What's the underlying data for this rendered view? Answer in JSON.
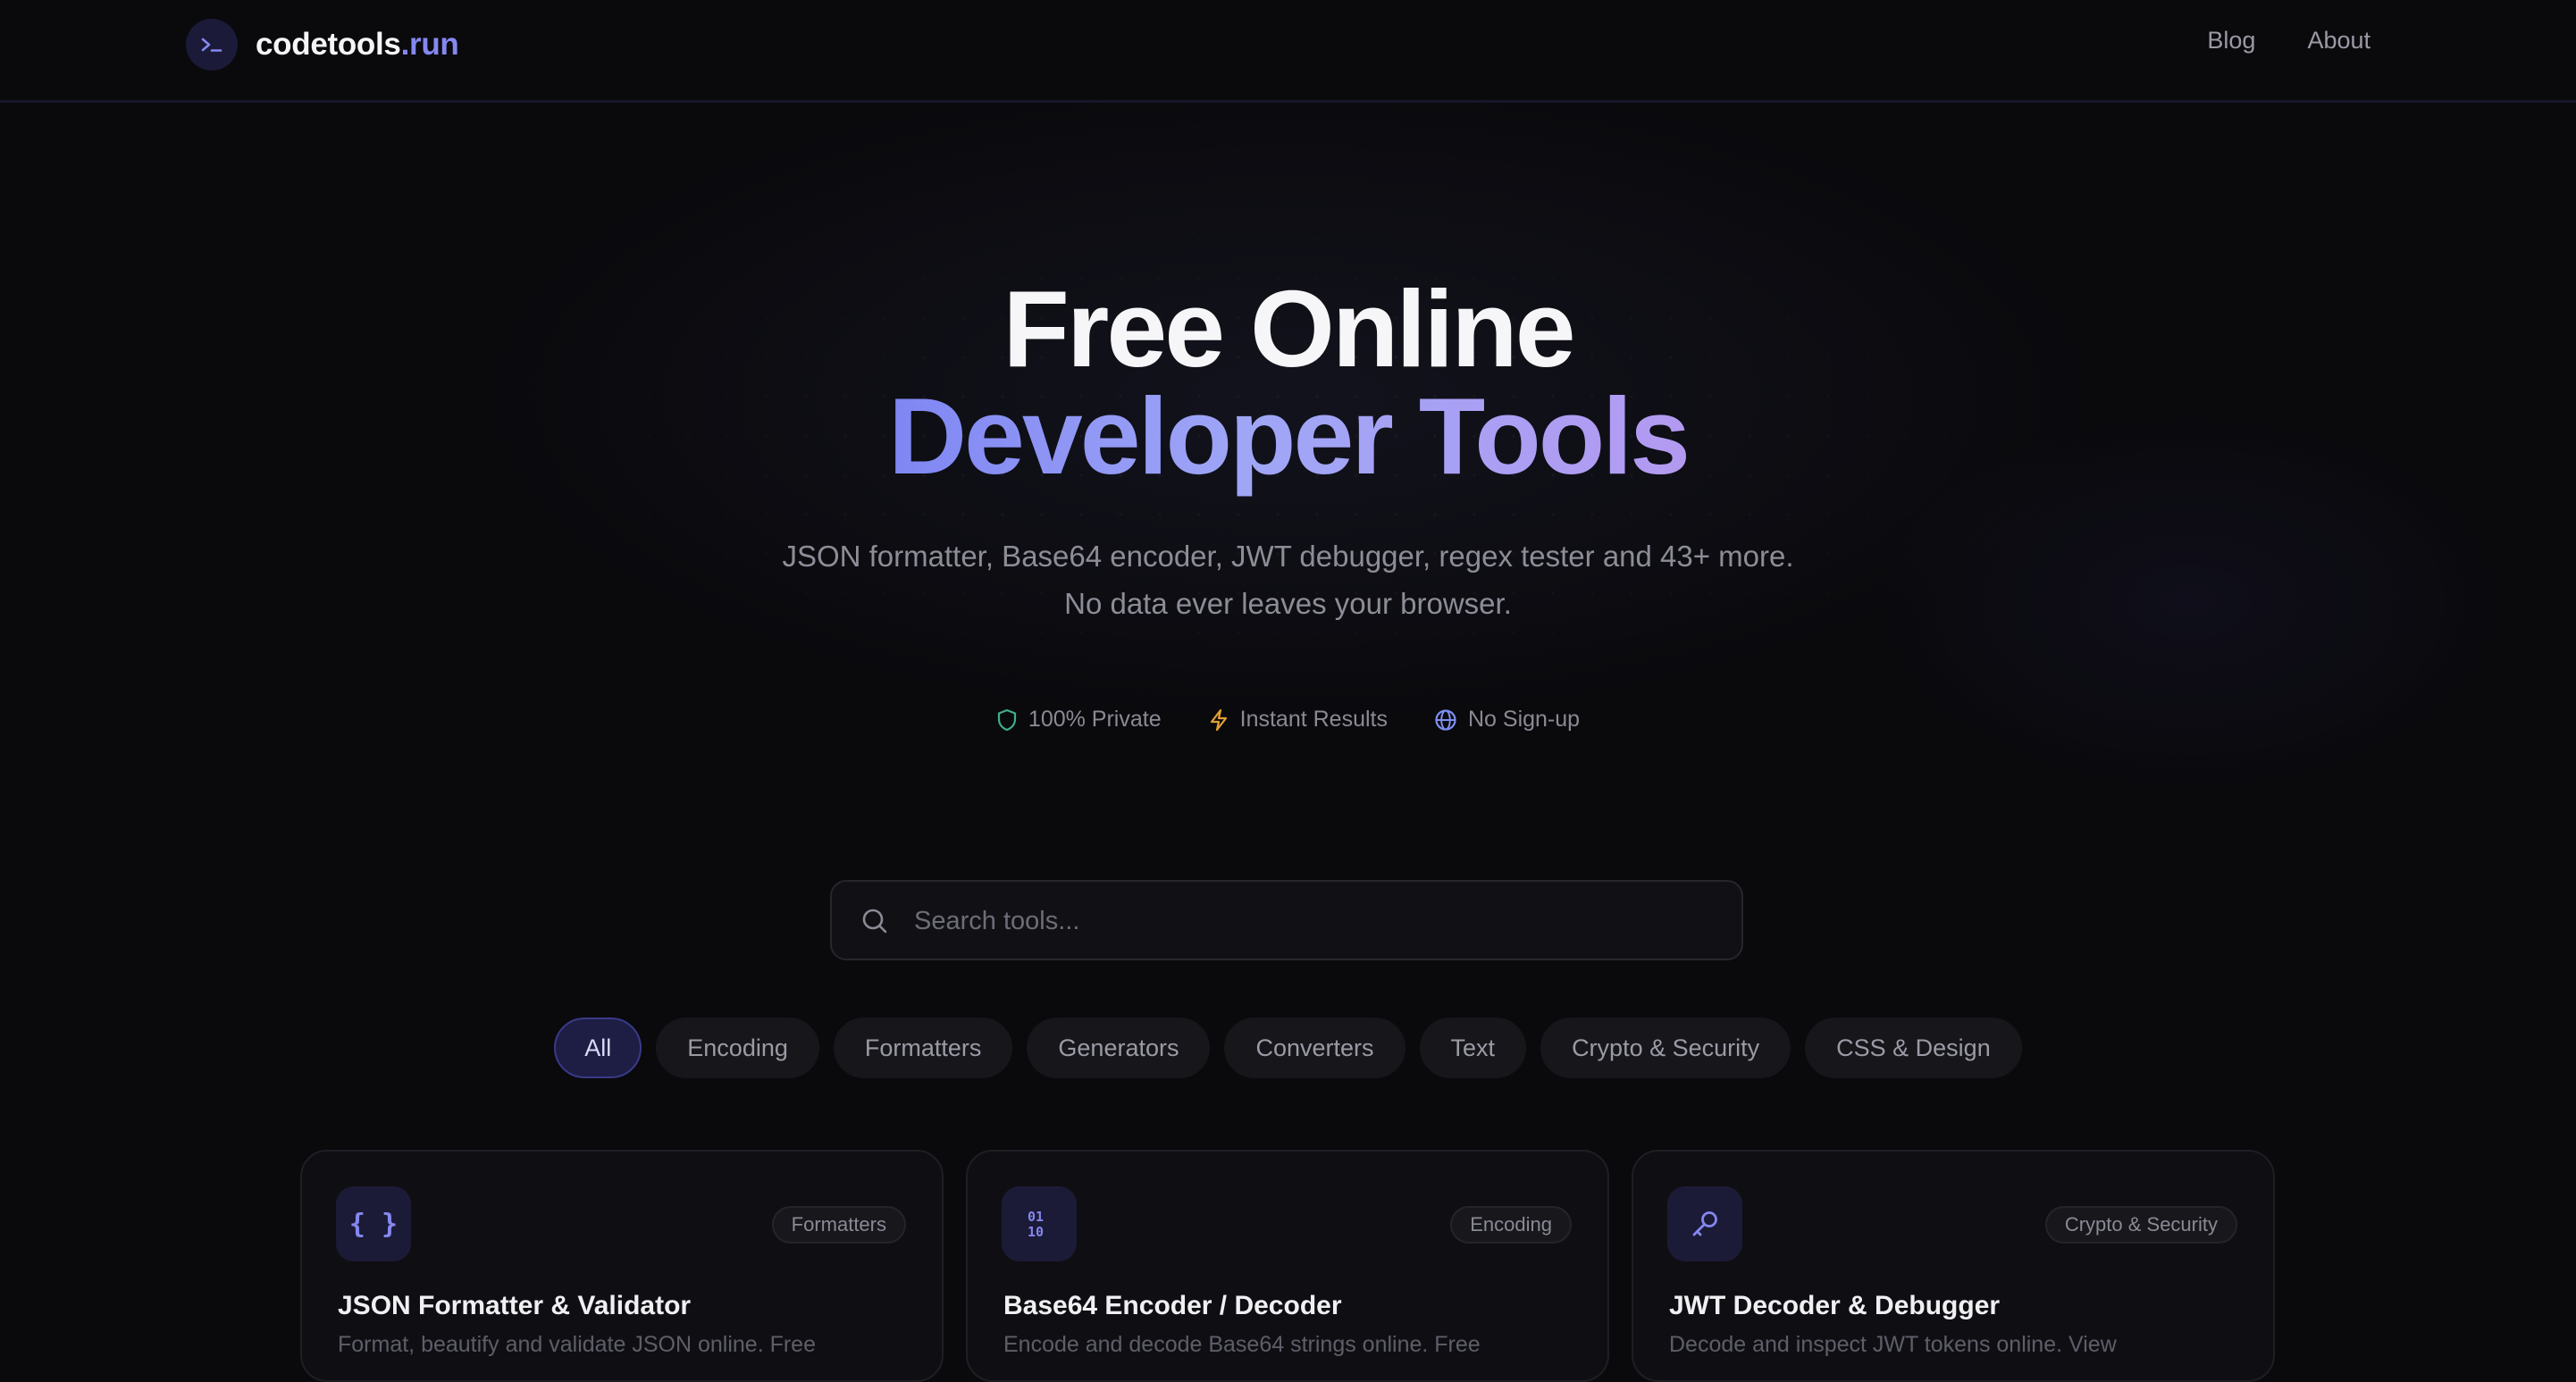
{
  "header": {
    "logo_text": "codetools",
    "logo_accent": ".run",
    "logo_prompt": ">_",
    "nav": [
      {
        "label": "Blog"
      },
      {
        "label": "About"
      }
    ]
  },
  "hero": {
    "title_line1": "Free Online",
    "title_line2": "Developer Tools",
    "subtitle_line1": "JSON formatter, Base64 encoder, JWT debugger, regex tester and 43+ more.",
    "subtitle_line2": "No data ever leaves your browser.",
    "features": [
      {
        "label": "100% Private",
        "icon": "shield-icon",
        "color": "#3fae8a"
      },
      {
        "label": "Instant Results",
        "icon": "lightning-icon",
        "color": "#e0a132"
      },
      {
        "label": "No Sign-up",
        "icon": "globe-icon",
        "color": "#7d8ff0"
      }
    ]
  },
  "search": {
    "placeholder": "Search tools..."
  },
  "categories": [
    {
      "label": "All",
      "active": true
    },
    {
      "label": "Encoding"
    },
    {
      "label": "Formatters"
    },
    {
      "label": "Generators"
    },
    {
      "label": "Converters"
    },
    {
      "label": "Text"
    },
    {
      "label": "Crypto & Security"
    },
    {
      "label": "CSS & Design"
    }
  ],
  "tools": [
    {
      "icon_text": "{ }",
      "icon": "braces-icon",
      "category": "Formatters",
      "title": "JSON Formatter & Validator",
      "description": "Format, beautify and validate JSON online. Free"
    },
    {
      "icon_text": "01",
      "icon": "binary-icon",
      "category": "Encoding",
      "title": "Base64 Encoder / Decoder",
      "description": "Encode and decode Base64 strings online. Free"
    },
    {
      "icon_text": "",
      "icon": "key-icon",
      "category": "Crypto & Security",
      "title": "JWT Decoder & Debugger",
      "description": "Decode and inspect JWT tokens online. View"
    }
  ],
  "colors": {
    "background": "#0a0a0d",
    "accent": "#8587f0",
    "gradient_start": "#7f86f3",
    "gradient_end": "#b39af1"
  }
}
